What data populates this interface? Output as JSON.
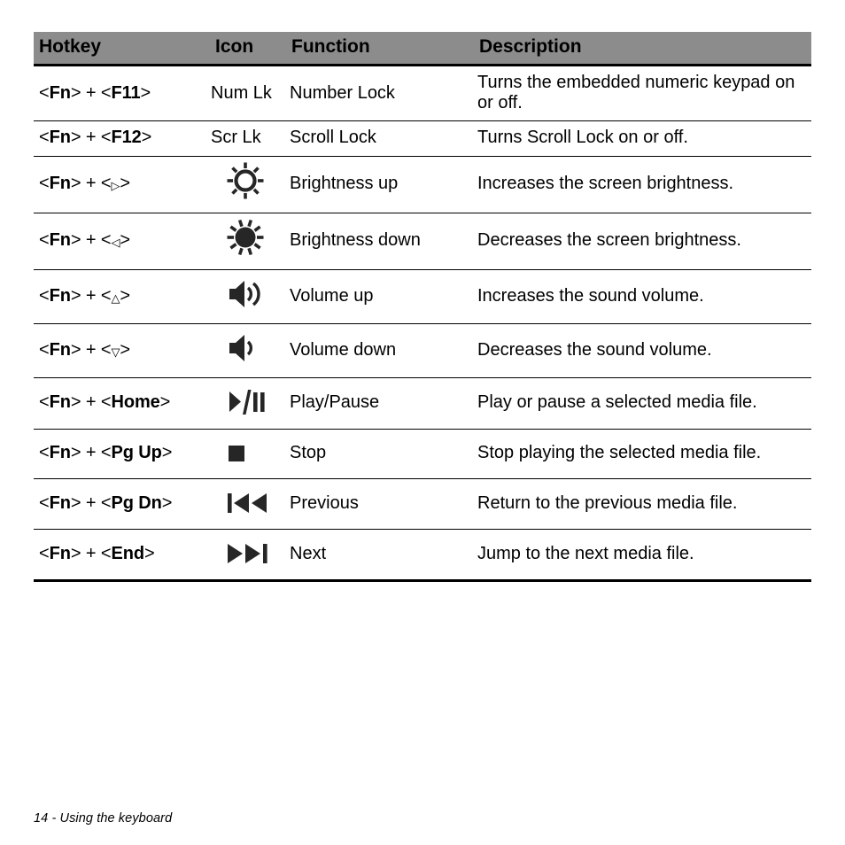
{
  "page": {
    "footer": "14 - Using the keyboard",
    "header_bg": "#8c8c8c",
    "text_color": "#000000",
    "background": "#ffffff"
  },
  "table": {
    "columns": [
      {
        "key": "hotkey",
        "label": "Hotkey"
      },
      {
        "key": "icon",
        "label": "Icon"
      },
      {
        "key": "function",
        "label": "Function"
      },
      {
        "key": "description",
        "label": "Description"
      }
    ],
    "rows": [
      {
        "hotkey_prefix": "<Fn>",
        "hotkey_plus": " + ",
        "hotkey_key": "<F11>",
        "hotkey_full": "<Fn> + <F11>",
        "icon_kind": "text",
        "icon_text": "Num Lk",
        "icon_name": "num-lock-text-icon",
        "function": "Number Lock",
        "description": "Turns the embedded numeric keypad on or off."
      },
      {
        "hotkey_prefix": "<Fn>",
        "hotkey_plus": " + ",
        "hotkey_key": "<F12>",
        "hotkey_full": "<Fn> + <F12>",
        "icon_kind": "text",
        "icon_text": "Scr Lk",
        "icon_name": "scroll-lock-text-icon",
        "function": "Scroll Lock",
        "description": "Turns Scroll Lock on or off."
      },
      {
        "hotkey_prefix": "<Fn>",
        "hotkey_plus": " + ",
        "hotkey_key": "< ▷ >",
        "hotkey_arrow": "▷",
        "hotkey_full": "<Fn> + < ▷ >",
        "icon_kind": "glyph",
        "icon_text": "",
        "icon_name": "brightness-up-icon",
        "function": "Brightness up",
        "description": "Increases the screen brightness."
      },
      {
        "hotkey_prefix": "<Fn>",
        "hotkey_plus": " + ",
        "hotkey_key": "< ◁ >",
        "hotkey_arrow": "◁",
        "hotkey_full": "<Fn> + < ◁ >",
        "icon_kind": "glyph",
        "icon_text": "",
        "icon_name": "brightness-down-icon",
        "function": "Brightness down",
        "description": "Decreases the screen brightness."
      },
      {
        "hotkey_prefix": "<Fn>",
        "hotkey_plus": " + ",
        "hotkey_key": "< △ >",
        "hotkey_arrow": "△",
        "hotkey_full": "<Fn> + < △ >",
        "icon_kind": "glyph",
        "icon_text": "",
        "icon_name": "volume-up-icon",
        "function": "Volume up",
        "description": "Increases the sound volume."
      },
      {
        "hotkey_prefix": "<Fn>",
        "hotkey_plus": " + ",
        "hotkey_key": "< ▽ >",
        "hotkey_arrow": "▽",
        "hotkey_full": "<Fn> + < ▽ >",
        "icon_kind": "glyph",
        "icon_text": "",
        "icon_name": "volume-down-icon",
        "function": "Volume down",
        "description": "Decreases the sound volume."
      },
      {
        "hotkey_prefix": "<Fn>",
        "hotkey_plus": " + ",
        "hotkey_key": "<Home>",
        "hotkey_full": "<Fn> + <Home>",
        "icon_kind": "glyph",
        "icon_text": "",
        "icon_name": "play-pause-icon",
        "function": "Play/Pause",
        "description": "Play or pause a selected media file."
      },
      {
        "hotkey_prefix": "<Fn>",
        "hotkey_plus": " + ",
        "hotkey_key": "<Pg Up>",
        "hotkey_full": "<Fn> + <Pg Up>",
        "icon_kind": "glyph",
        "icon_text": "",
        "icon_name": "stop-icon",
        "function": "Stop",
        "description": "Stop playing the selected media file."
      },
      {
        "hotkey_prefix": "<Fn>",
        "hotkey_plus": " + ",
        "hotkey_key": "<Pg Dn>",
        "hotkey_full": "<Fn> + <Pg Dn>",
        "icon_kind": "glyph",
        "icon_text": "",
        "icon_name": "previous-track-icon",
        "function": "Previous",
        "description": "Return to the previous media file."
      },
      {
        "hotkey_prefix": "<Fn>",
        "hotkey_plus": " + ",
        "hotkey_key": "<End>",
        "hotkey_full": "<Fn> + <End>",
        "icon_kind": "glyph",
        "icon_text": "",
        "icon_name": "next-track-icon",
        "function": "Next",
        "description": "Jump to the next media file."
      }
    ]
  }
}
